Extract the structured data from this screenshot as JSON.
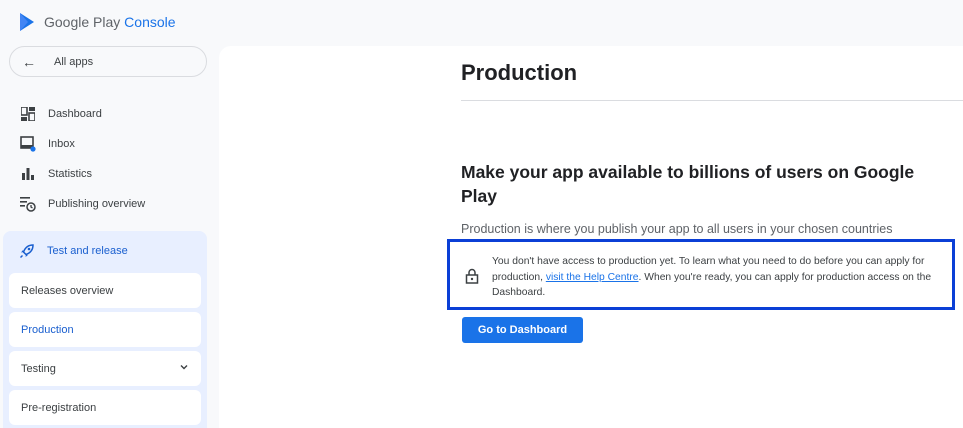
{
  "header": {
    "brand": "Google Play",
    "product": "Console"
  },
  "sidebar": {
    "all_apps": "All apps",
    "items": [
      {
        "label": "Dashboard",
        "icon": "dashboard-icon"
      },
      {
        "label": "Inbox",
        "icon": "inbox-icon"
      },
      {
        "label": "Statistics",
        "icon": "statistics-icon"
      },
      {
        "label": "Publishing overview",
        "icon": "publishing-icon"
      }
    ],
    "section": {
      "label": "Test and release",
      "icon": "rocket-icon",
      "subitems": [
        {
          "label": "Releases overview"
        },
        {
          "label": "Production"
        },
        {
          "label": "Testing"
        },
        {
          "label": "Pre-registration"
        }
      ]
    }
  },
  "main": {
    "title": "Production",
    "heading": "Make your app available to billions of users on Google Play",
    "description": "Production is where you publish your app to all users in your chosen countries",
    "notice": {
      "text_before": "You don't have access to production yet. To learn what you need to do before you can apply for production, ",
      "link": "visit the Help Centre",
      "text_after": ". When you're ready, you can apply for production access on the Dashboard."
    },
    "button": "Go to Dashboard"
  },
  "colors": {
    "accent": "#1a73e8",
    "section_bg": "#e8efff",
    "highlight_border": "#0b3fd6"
  }
}
